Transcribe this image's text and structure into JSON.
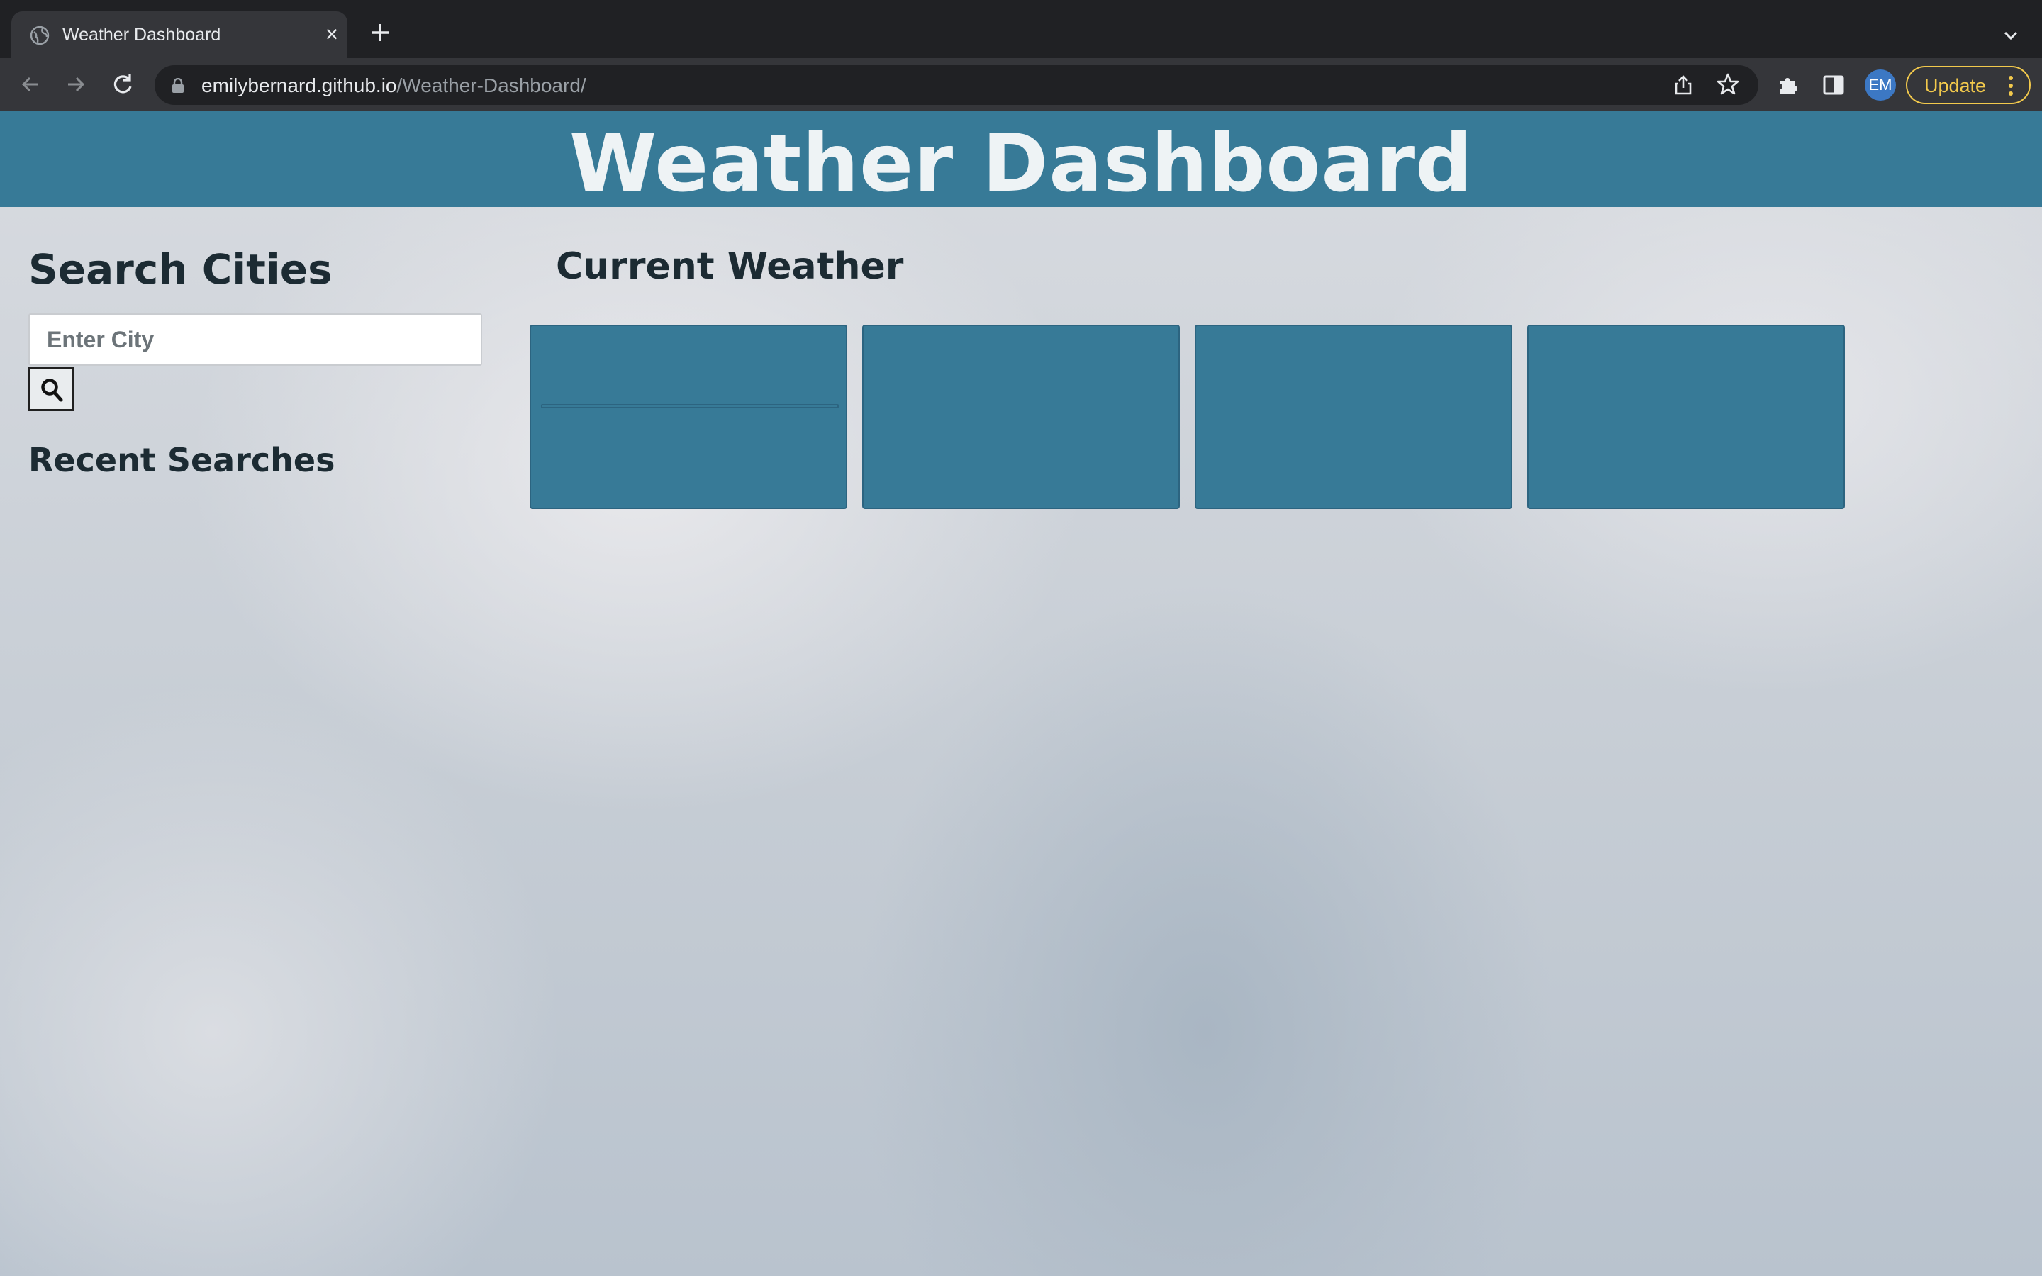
{
  "browser": {
    "tab_title": "Weather Dashboard",
    "url_host": "emilybernard.github.io",
    "url_path": "/Weather-Dashboard/",
    "profile_initials": "EM",
    "update_label": "Update"
  },
  "page": {
    "header_title": "Weather Dashboard",
    "search": {
      "title": "Search Cities",
      "placeholder": "Enter City",
      "value": ""
    },
    "recent": {
      "title": "Recent Searches"
    },
    "current": {
      "title": "Current Weather"
    },
    "cards": [
      {},
      {},
      {},
      {}
    ]
  },
  "colors": {
    "header_bg": "#377a97",
    "card_bg": "#377a97",
    "update_accent": "#f2c94c"
  }
}
